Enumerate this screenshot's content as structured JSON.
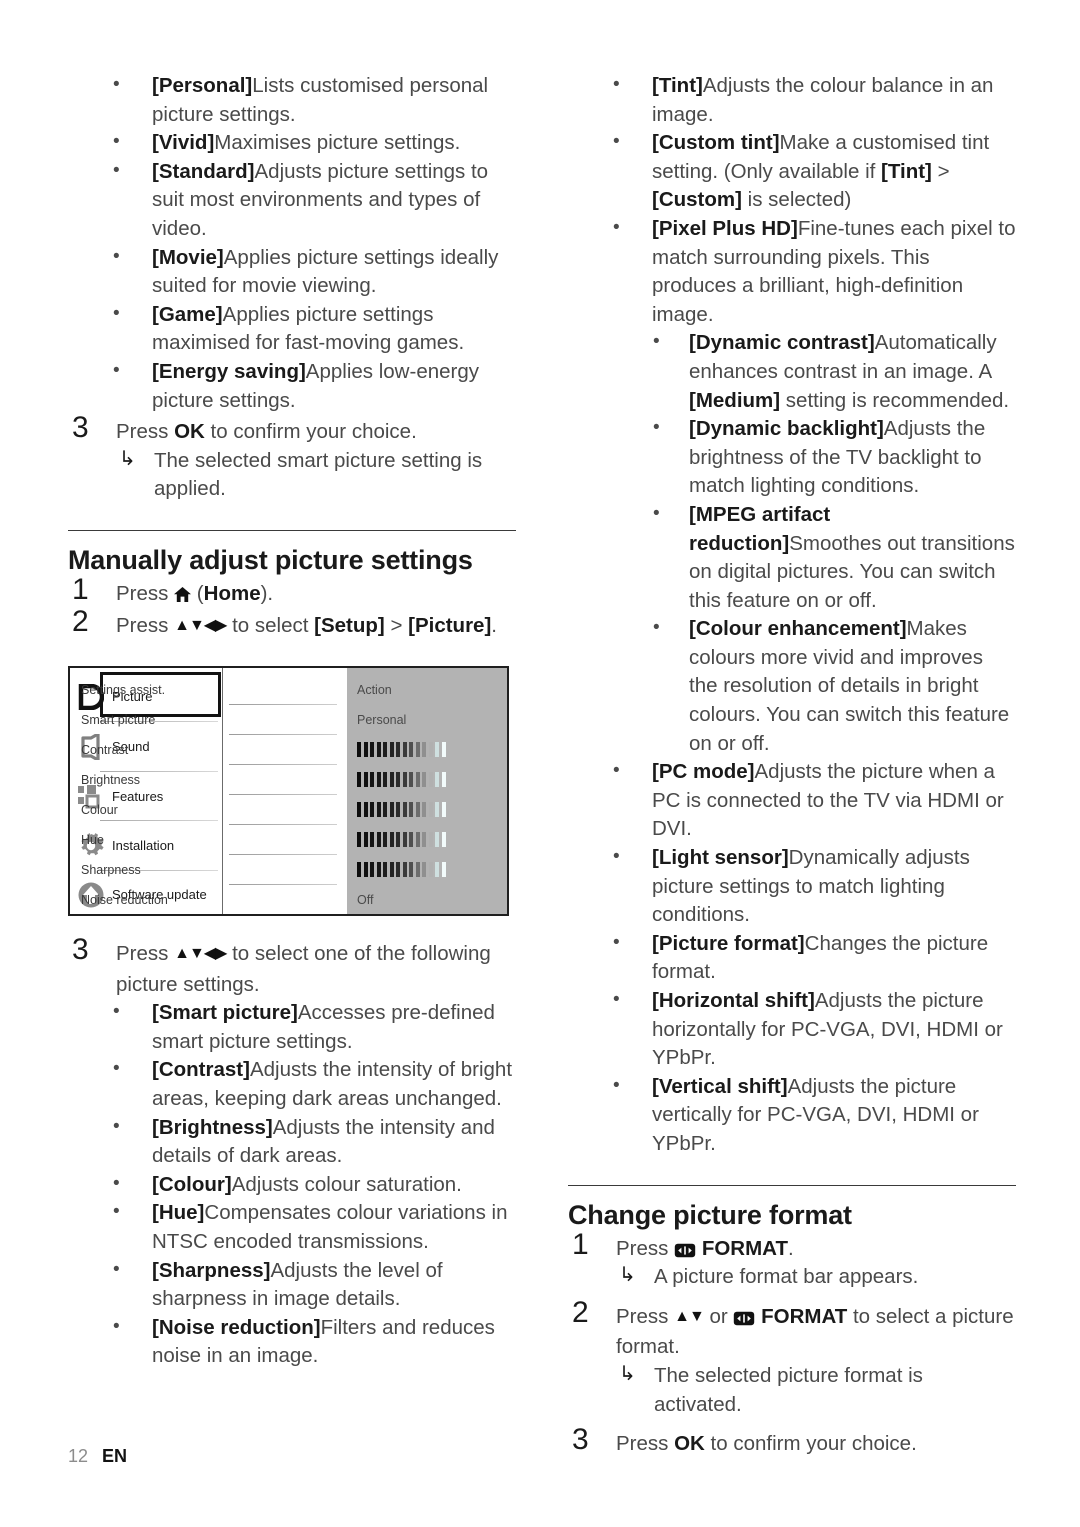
{
  "page": {
    "number": "12",
    "language": "EN"
  },
  "left_column": {
    "smart_picture_options": [
      {
        "term": "[Personal]",
        "desc": "Lists customised personal picture settings."
      },
      {
        "term": "[Vivid]",
        "desc": "Maximises picture settings."
      },
      {
        "term": "[Standard]",
        "desc": "Adjusts picture settings to suit most environments and types of video."
      },
      {
        "term": "[Movie]",
        "desc": "Applies picture settings ideally suited for movie viewing."
      },
      {
        "term": "[Game]",
        "desc": "Applies picture settings maximised for fast-moving games."
      },
      {
        "term": "[Energy saving]",
        "desc": "Applies low-energy picture settings."
      }
    ],
    "step3": {
      "num": "3",
      "pre": "Press ",
      "key": "OK",
      "post": " to confirm your choice.",
      "result": "The selected smart picture setting is applied."
    },
    "section_title": "Manually adjust picture settings",
    "step1": {
      "num": "1",
      "pre": "Press ",
      "icon": "home-icon",
      "paren_open": " (",
      "key": "Home",
      "paren_close": ")."
    },
    "step2": {
      "num": "2",
      "pre": "Press ",
      "arrows": "▲▼◀▶",
      "mid": " to select ",
      "key1": "[Setup]",
      "gt": " > ",
      "key2": "[Picture]",
      "end": "."
    },
    "step3b": {
      "num": "3",
      "pre": "Press ",
      "arrows": "▲▼◀▶",
      "post": " to select one of the following picture settings."
    },
    "picture_settings": [
      {
        "term": "[Smart picture]",
        "desc": "Accesses pre-defined smart picture settings."
      },
      {
        "term": "[Contrast]",
        "desc": "Adjusts the intensity of bright areas, keeping dark areas unchanged."
      },
      {
        "term": "[Brightness]",
        "desc": "Adjusts the intensity and details of dark areas."
      },
      {
        "term": "[Colour]",
        "desc": "Adjusts colour saturation."
      },
      {
        "term": "[Hue]",
        "desc": "Compensates colour variations in NTSC encoded transmissions."
      },
      {
        "term": "[Sharpness]",
        "desc": "Adjusts the level of sharpness in image details."
      },
      {
        "term": "[Noise reduction]",
        "desc": "Filters and reduces noise in an image."
      }
    ]
  },
  "tv_menu": {
    "categories": [
      {
        "label": "Picture",
        "icon": "display-icon",
        "selected": true
      },
      {
        "label": "Sound",
        "icon": "speaker-icon",
        "selected": false
      },
      {
        "label": "Features",
        "icon": "squares-icon",
        "selected": false
      },
      {
        "label": "Installation",
        "icon": "gear-icon",
        "selected": false
      },
      {
        "label": "Software update",
        "icon": "circle-up-arrow-icon",
        "selected": false
      }
    ],
    "settings": [
      {
        "label": "Settings assist.",
        "value": "Action",
        "type": "text"
      },
      {
        "label": "Smart picture",
        "value": "Personal",
        "type": "text"
      },
      {
        "label": "Contrast",
        "value": "",
        "type": "gauge",
        "level": 10
      },
      {
        "label": "Brightness",
        "value": "",
        "type": "gauge",
        "level": 10
      },
      {
        "label": "Colour",
        "value": "",
        "type": "gauge",
        "level": 10
      },
      {
        "label": "Hue",
        "value": "",
        "type": "gauge",
        "level": 10
      },
      {
        "label": "Sharpness",
        "value": "",
        "type": "gauge",
        "level": 10
      },
      {
        "label": "Noise reduction",
        "value": "Off",
        "type": "text"
      }
    ],
    "gauge_ticks": 14
  },
  "right_column": {
    "picture_settings_cont": [
      {
        "term": "[Tint]",
        "desc": "Adjusts the colour balance in an image."
      },
      {
        "term": "[Custom tint]",
        "desc": "Make a customised tint setting. (Only available if ",
        "key_a": "[Tint]",
        "mid": " > ",
        "key_b": "[Custom]",
        "tail": " is selected)"
      },
      {
        "term": "[Pixel Plus HD]",
        "desc": "Fine-tunes each pixel to match surrounding pixels. This produces a brilliant, high-definition image."
      }
    ],
    "pixel_plus_sub": [
      {
        "term": "[Dynamic contrast]",
        "desc": "Automatically enhances contrast in an image. A ",
        "key_a": "[Medium]",
        "tail": " setting is recommended."
      },
      {
        "term": "[Dynamic backlight]",
        "desc": "Adjusts the brightness of the TV backlight to match lighting conditions."
      },
      {
        "term": "[MPEG artifact reduction]",
        "desc": "Smoothes out transitions on digital pictures. You can switch this feature on or off."
      },
      {
        "term": "[Colour enhancement]",
        "desc": "Makes colours more vivid and improves the resolution of details in bright colours. You can switch this feature on or off."
      }
    ],
    "picture_settings_tail": [
      {
        "term": "[PC mode]",
        "desc": "Adjusts the picture when a PC is connected to the TV via HDMI or DVI."
      },
      {
        "term": "[Light sensor]",
        "desc": "Dynamically adjusts picture settings to match lighting conditions."
      },
      {
        "term": "[Picture format]",
        "desc": "Changes the picture format."
      },
      {
        "term": "[Horizontal shift]",
        "desc": "Adjusts the picture horizontally for PC-VGA, DVI, HDMI or YPbPr."
      },
      {
        "term": "[Vertical shift]",
        "desc": "Adjusts the picture vertically for PC-VGA, DVI, HDMI or YPbPr."
      }
    ],
    "section_title": "Change picture format",
    "fmt_step1": {
      "num": "1",
      "pre": "Press ",
      "icon": "format-icon",
      "key": "FORMAT",
      "post": ".",
      "result": "A picture format bar appears."
    },
    "fmt_step2": {
      "num": "2",
      "pre": "Press ",
      "arrows": "▲▼",
      "or": " or ",
      "icon": "format-icon",
      "key": "FORMAT",
      "post": " to select a picture format.",
      "result": "The selected picture format is activated."
    },
    "fmt_step3": {
      "num": "3",
      "pre": "Press ",
      "key": "OK",
      "post": " to confirm your choice."
    }
  },
  "colors": {
    "body_text": "#4a4a4a",
    "bold_text": "#1a1a1a",
    "menu_panel": "#b3b3b3",
    "menu_border": "#1f1f1f"
  }
}
